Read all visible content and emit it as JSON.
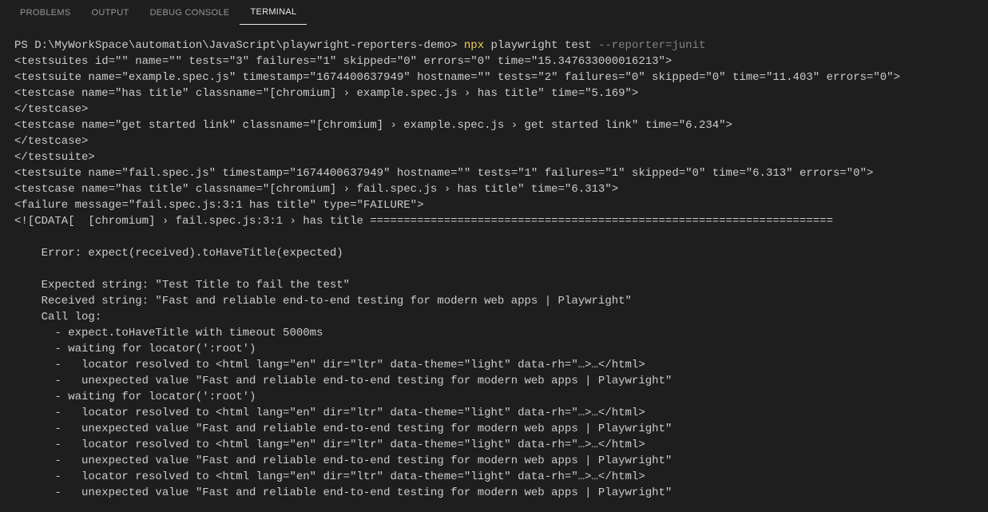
{
  "tabs": {
    "problems": "PROBLEMS",
    "output": "OUTPUT",
    "debug_console": "DEBUG CONSOLE",
    "terminal": "TERMINAL"
  },
  "terminal": {
    "prompt": "PS D:\\MyWorkSpace\\automation\\JavaScript\\playwright-reporters-demo> ",
    "cmd_npx": "npx",
    "cmd_args": " playwright test ",
    "cmd_flag": "--reporter=junit",
    "l1": "<testsuites id=\"\" name=\"\" tests=\"3\" failures=\"1\" skipped=\"0\" errors=\"0\" time=\"15.347633000016213\">",
    "l2": "<testsuite name=\"example.spec.js\" timestamp=\"1674400637949\" hostname=\"\" tests=\"2\" failures=\"0\" skipped=\"0\" time=\"11.403\" errors=\"0\">",
    "l3": "<testcase name=\"has title\" classname=\"[chromium] › example.spec.js › has title\" time=\"5.169\">",
    "l4": "</testcase>",
    "l5": "<testcase name=\"get started link\" classname=\"[chromium] › example.spec.js › get started link\" time=\"6.234\">",
    "l6": "</testcase>",
    "l7": "</testsuite>",
    "l8": "<testsuite name=\"fail.spec.js\" timestamp=\"1674400637949\" hostname=\"\" tests=\"1\" failures=\"1\" skipped=\"0\" time=\"6.313\" errors=\"0\">",
    "l9": "<testcase name=\"has title\" classname=\"[chromium] › fail.spec.js › has title\" time=\"6.313\">",
    "l10": "<failure message=\"fail.spec.js:3:1 has title\" type=\"FAILURE\">",
    "l11": "<![CDATA[  [chromium] › fail.spec.js:3:1 › has title =====================================================================",
    "l12": "",
    "l13": "    Error: expect(received).toHaveTitle(expected)",
    "l14": "",
    "l15": "    Expected string: \"Test Title to fail the test\"",
    "l16": "    Received string: \"Fast and reliable end-to-end testing for modern web apps | Playwright\"",
    "l17": "    Call log:",
    "l18": "      - expect.toHaveTitle with timeout 5000ms",
    "l19": "      - waiting for locator(':root')",
    "l20": "      -   locator resolved to <html lang=\"en\" dir=\"ltr\" data-theme=\"light\" data-rh=\"…>…</html>",
    "l21": "      -   unexpected value \"Fast and reliable end-to-end testing for modern web apps | Playwright\"",
    "l22": "      - waiting for locator(':root')",
    "l23": "      -   locator resolved to <html lang=\"en\" dir=\"ltr\" data-theme=\"light\" data-rh=\"…>…</html>",
    "l24": "      -   unexpected value \"Fast and reliable end-to-end testing for modern web apps | Playwright\"",
    "l25": "      -   locator resolved to <html lang=\"en\" dir=\"ltr\" data-theme=\"light\" data-rh=\"…>…</html>",
    "l26": "      -   unexpected value \"Fast and reliable end-to-end testing for modern web apps | Playwright\"",
    "l27": "      -   locator resolved to <html lang=\"en\" dir=\"ltr\" data-theme=\"light\" data-rh=\"…>…</html>",
    "l28": "      -   unexpected value \"Fast and reliable end-to-end testing for modern web apps | Playwright\""
  }
}
